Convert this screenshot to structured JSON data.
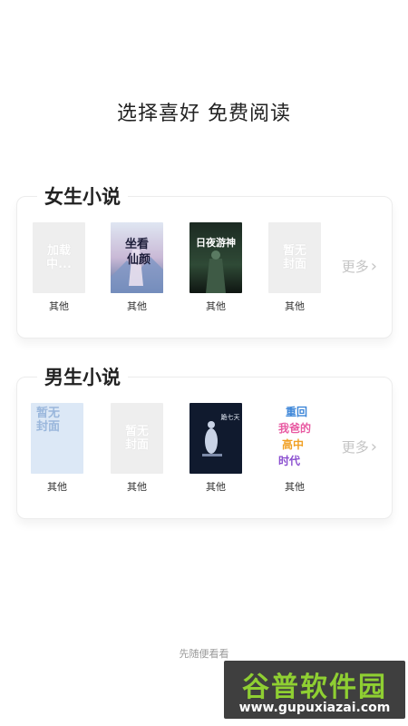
{
  "header": {
    "title": "选择喜好 免费阅读"
  },
  "sections": [
    {
      "title": "女生小说",
      "more_label": "更多",
      "books": [
        {
          "label": "其他",
          "placeholder": [
            "加载",
            "中..."
          ]
        },
        {
          "label": "其他",
          "cover_text": "坐看仙颜"
        },
        {
          "label": "其他",
          "cover_text": "日夜游神"
        },
        {
          "label": "其他",
          "placeholder": [
            "暂无",
            "封面"
          ]
        }
      ]
    },
    {
      "title": "男生小说",
      "more_label": "更多",
      "books": [
        {
          "label": "其他",
          "placeholder": [
            "暂无",
            "封面"
          ]
        },
        {
          "label": "其他",
          "placeholder": [
            "暂无",
            "封面"
          ]
        },
        {
          "label": "其他",
          "cover_text": "跪七天"
        },
        {
          "label": "其他",
          "cover_text": "重回我爸的高中时代"
        }
      ]
    }
  ],
  "footer": {
    "skip_label": "先随便看看"
  },
  "watermark": {
    "top": "谷普软件园",
    "bottom": "www.gupuxiazai.com"
  },
  "colors": {
    "accent": "#8fcf32",
    "more": "#c4c4c4"
  }
}
